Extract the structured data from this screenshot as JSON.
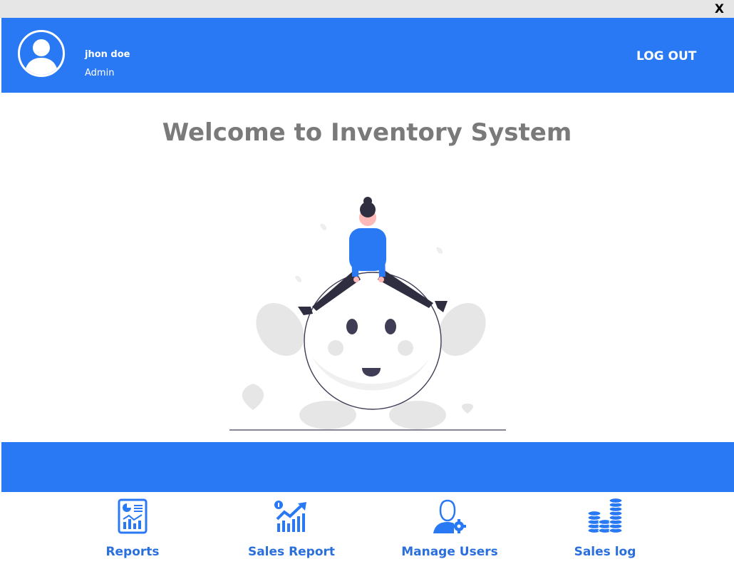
{
  "window": {
    "close_label": "X"
  },
  "header": {
    "user_name": "jhon doe",
    "user_role": "Admin",
    "logout_label": "LOG OUT"
  },
  "main": {
    "welcome_title": "Welcome to Inventory System"
  },
  "nav": {
    "items": [
      {
        "label": "Reports",
        "icon": "report-icon"
      },
      {
        "label": "Sales Report",
        "icon": "sales-chart-icon"
      },
      {
        "label": "Manage Users",
        "icon": "user-settings-icon"
      },
      {
        "label": "Sales log",
        "icon": "coin-stack-icon"
      }
    ]
  },
  "colors": {
    "accent": "#2979f5",
    "title_gray": "#7a7a7a",
    "nav_label": "#2a6fdb"
  }
}
